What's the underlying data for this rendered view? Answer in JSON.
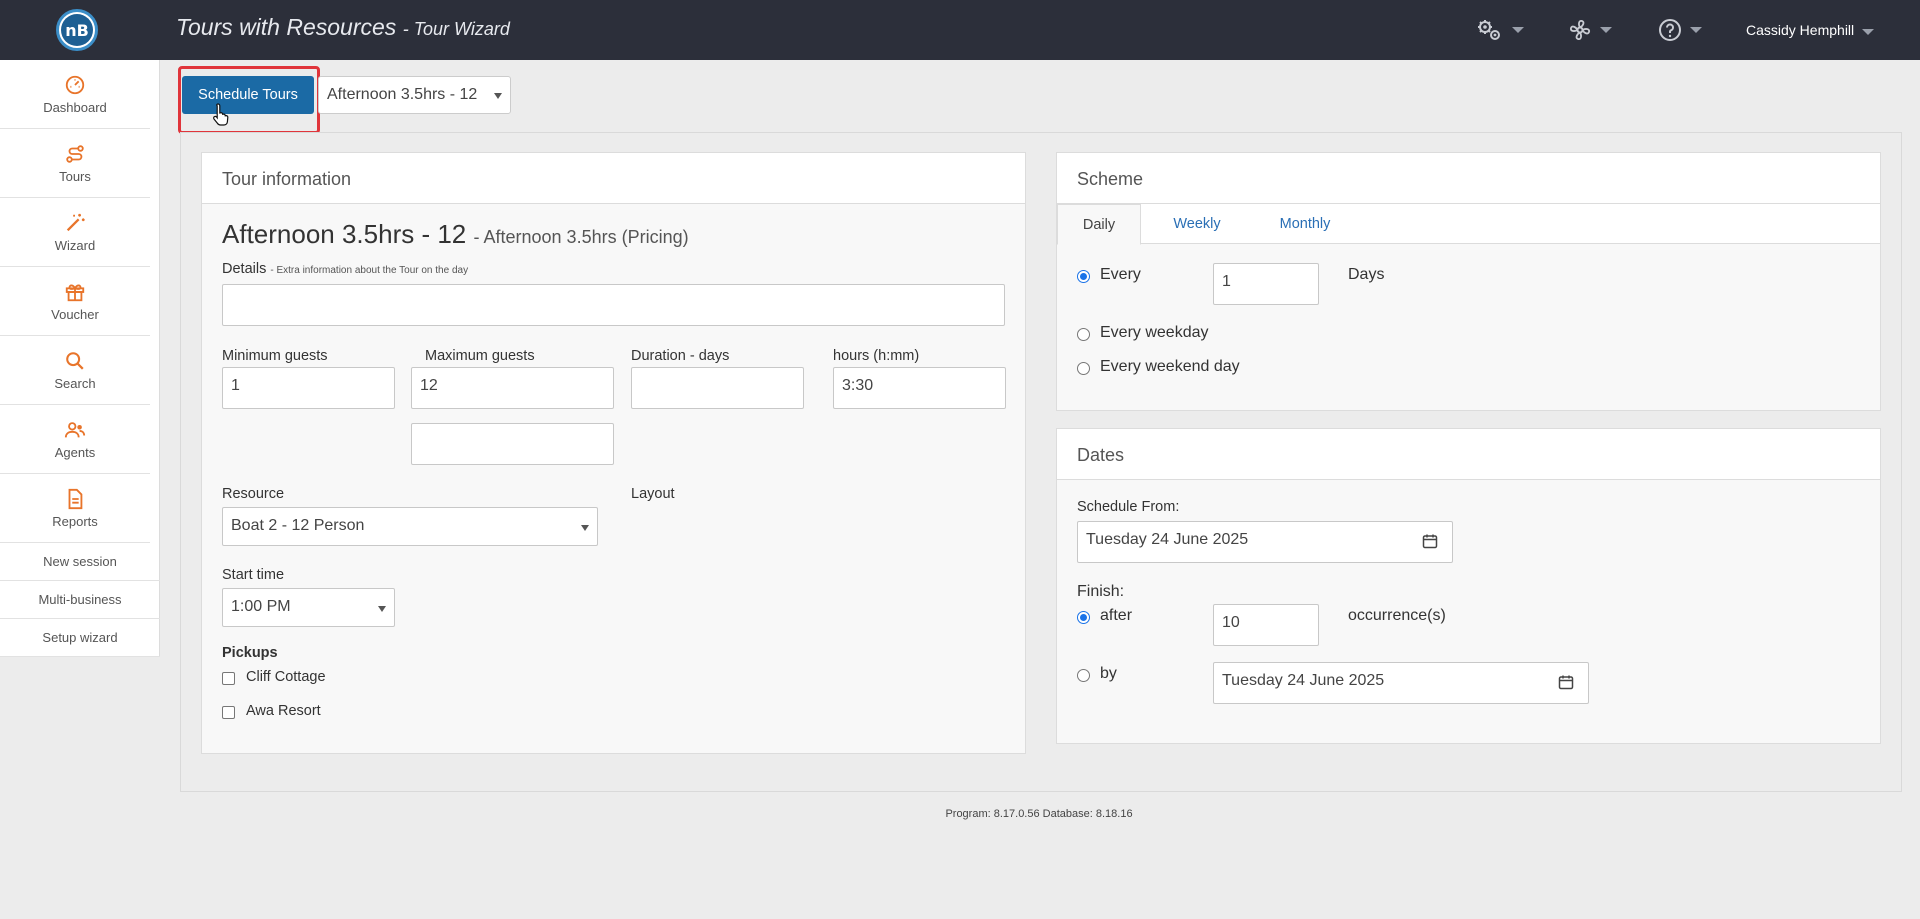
{
  "header": {
    "title": "Tours with Resources",
    "subtitle": "Tour Wizard",
    "logo_text": "nB",
    "user_name": "Cassidy Hemphill"
  },
  "sidebar": {
    "items": [
      {
        "label": "Dashboard",
        "icon": "dashboard-gauge-icon"
      },
      {
        "label": "Tours",
        "icon": "route-icon"
      },
      {
        "label": "Wizard",
        "icon": "magic-wand-icon"
      },
      {
        "label": "Voucher",
        "icon": "gift-icon"
      },
      {
        "label": "Search",
        "icon": "search-icon"
      },
      {
        "label": "Agents",
        "icon": "users-icon"
      },
      {
        "label": "Reports",
        "icon": "document-icon"
      }
    ],
    "links": [
      "New session",
      "Multi-business",
      "Setup wizard"
    ],
    "accent_color": "#e8742a"
  },
  "toolbar": {
    "schedule_label": "Schedule Tours",
    "tour_select_value": "Afternoon 3.5hrs - 12"
  },
  "tour_info": {
    "panel_title": "Tour information",
    "tour_name": "Afternoon 3.5hrs - 12",
    "tour_pricing": "- Afternoon 3.5hrs (Pricing)",
    "details_label": "Details",
    "details_hint": "- Extra information about the Tour on the day",
    "details_value": "",
    "min_guests_label": "Minimum guests",
    "min_guests_value": "1",
    "max_guests_label": "Maximum guests",
    "max_guests_value": "12",
    "extra_value": "",
    "duration_label": "Duration - days",
    "duration_value": "",
    "hours_label": "hours (h:mm)",
    "hours_value": "3:30",
    "resource_label": "Resource",
    "resource_value": "Boat 2 - 12 Person",
    "layout_label": "Layout",
    "start_time_label": "Start time",
    "start_time_value": "1:00 PM",
    "pickups_label": "Pickups",
    "pickups": [
      "Cliff Cottage",
      "Awa Resort"
    ]
  },
  "scheme": {
    "panel_title": "Scheme",
    "tabs": [
      "Daily",
      "Weekly",
      "Monthly"
    ],
    "every_label": "Every",
    "every_value": "1",
    "days_label": "Days",
    "weekday_label": "Every weekday",
    "weekend_label": "Every weekend day"
  },
  "dates": {
    "panel_title": "Dates",
    "schedule_from_label": "Schedule From:",
    "schedule_from_value": "Tuesday 24 June 2025",
    "finish_label": "Finish:",
    "after_label": "after",
    "after_value": "10",
    "occurrences_label": "occurrence(s)",
    "by_label": "by",
    "by_value": "Tuesday 24 June 2025"
  },
  "footer": {
    "version_text": "Program: 8.17.0.56 Database: 8.18.16"
  }
}
